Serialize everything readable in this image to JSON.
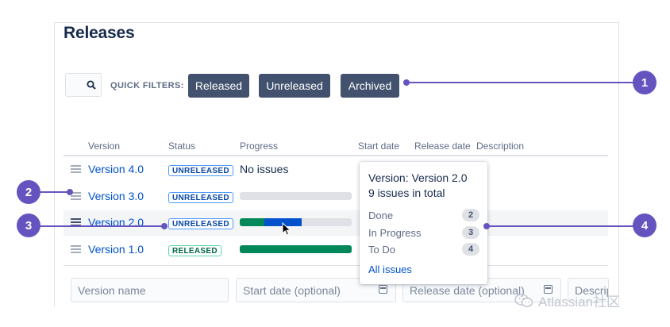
{
  "page": {
    "title": "Releases"
  },
  "filters": {
    "label": "QUICK FILTERS:",
    "buttons": [
      {
        "label": "Released"
      },
      {
        "label": "Unreleased"
      },
      {
        "label": "Archived"
      }
    ]
  },
  "table": {
    "columns": [
      "Version",
      "Status",
      "Progress",
      "Start date",
      "Release date",
      "Description"
    ],
    "rows": [
      {
        "version": "Version 4.0",
        "status": "UNRELEASED",
        "progress_text": "No issues"
      },
      {
        "version": "Version 3.0",
        "status": "UNRELEASED",
        "progress": {
          "done": 0,
          "in_progress": 0,
          "todo": 1
        }
      },
      {
        "version": "Version 2.0",
        "status": "UNRELEASED",
        "progress": {
          "done": 2,
          "in_progress": 3,
          "todo": 4
        }
      },
      {
        "version": "Version 1.0",
        "status": "RELEASED",
        "progress": {
          "done": 1,
          "in_progress": 0,
          "todo": 0
        }
      }
    ]
  },
  "form": {
    "version_name_placeholder": "Version name",
    "start_date_placeholder": "Start date (optional)",
    "release_date_placeholder": "Release date (optional)",
    "description_placeholder": "Description"
  },
  "popup": {
    "title": "Version: Version 2.0",
    "total": "9 issues in total",
    "rows": [
      {
        "label": "Done",
        "count": "2"
      },
      {
        "label": "In Progress",
        "count": "3"
      },
      {
        "label": "To Do",
        "count": "4"
      }
    ],
    "link": "All issues"
  },
  "callouts": [
    "1",
    "2",
    "3",
    "4"
  ],
  "watermark": "Atlassian社区",
  "colors": {
    "done": "#00875a",
    "in_progress": "#0052cc",
    "todo": "#dfe1e6",
    "callout": "#6554c0",
    "filter_button": "#42526e",
    "link": "#0052cc"
  },
  "icons": {
    "search": "search-icon",
    "calendar": "calendar-icon",
    "drag": "drag-handle-icon",
    "wechat": "wechat-icon"
  }
}
